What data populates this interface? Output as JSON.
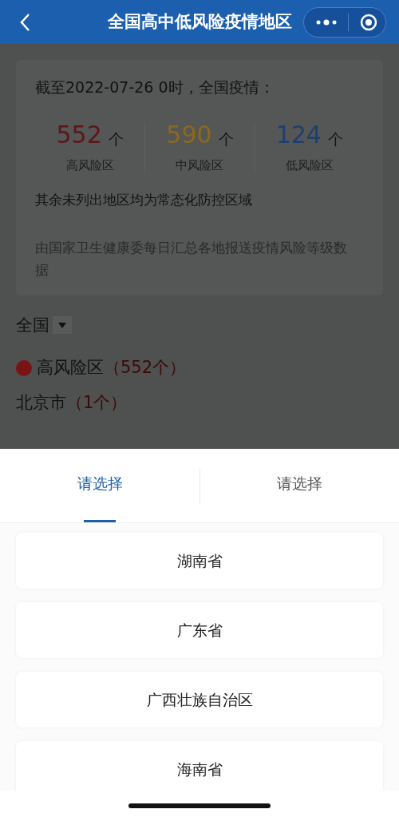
{
  "header": {
    "title": "全国高中低风险疫情地区"
  },
  "summary": {
    "heading": "截至2022-07-26 0时，全国疫情：",
    "stats": [
      {
        "value": "552",
        "unit": "个",
        "label": "高风险区",
        "color": "#5c1618"
      },
      {
        "value": "590",
        "unit": "个",
        "label": "中风险区",
        "color": "#8a6a1e"
      },
      {
        "value": "124",
        "unit": "个",
        "label": "低风险区",
        "color": "#1f3f6e"
      }
    ],
    "note": "其余未列出地区均为常态化防控区域",
    "source": "由国家卫生健康委每日汇总各地报送疫情风险等级数据"
  },
  "region_filter": {
    "label": "全国"
  },
  "risk_section": {
    "label": "高风险区",
    "count": "（552个）",
    "color": "#7a1414"
  },
  "city": {
    "name": "北京市",
    "count": "（1个）"
  },
  "picker": {
    "tabs": [
      {
        "label": "请选择",
        "selected": true
      },
      {
        "label": "请选择",
        "selected": false
      }
    ],
    "options": [
      "湖南省",
      "广东省",
      "广西壮族自治区",
      "海南省"
    ]
  }
}
